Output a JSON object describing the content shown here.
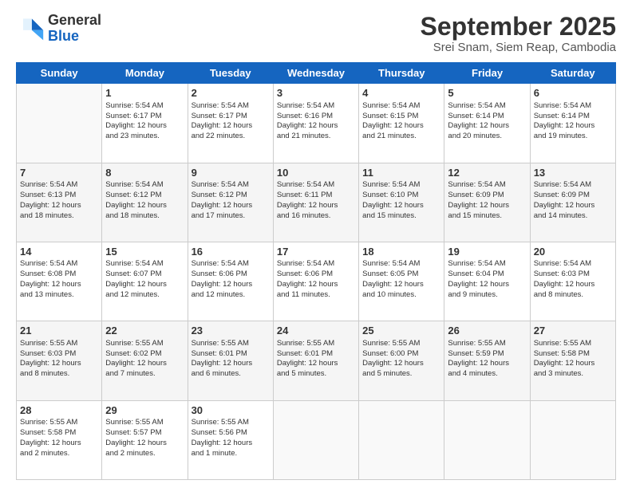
{
  "header": {
    "logo": {
      "general": "General",
      "blue": "Blue"
    },
    "title": "September 2025",
    "location": "Srei Snam, Siem Reap, Cambodia"
  },
  "days_of_week": [
    "Sunday",
    "Monday",
    "Tuesday",
    "Wednesday",
    "Thursday",
    "Friday",
    "Saturday"
  ],
  "weeks": [
    {
      "shade": false,
      "days": [
        {
          "num": "",
          "info": ""
        },
        {
          "num": "1",
          "info": "Sunrise: 5:54 AM\nSunset: 6:17 PM\nDaylight: 12 hours\nand 23 minutes."
        },
        {
          "num": "2",
          "info": "Sunrise: 5:54 AM\nSunset: 6:17 PM\nDaylight: 12 hours\nand 22 minutes."
        },
        {
          "num": "3",
          "info": "Sunrise: 5:54 AM\nSunset: 6:16 PM\nDaylight: 12 hours\nand 21 minutes."
        },
        {
          "num": "4",
          "info": "Sunrise: 5:54 AM\nSunset: 6:15 PM\nDaylight: 12 hours\nand 21 minutes."
        },
        {
          "num": "5",
          "info": "Sunrise: 5:54 AM\nSunset: 6:14 PM\nDaylight: 12 hours\nand 20 minutes."
        },
        {
          "num": "6",
          "info": "Sunrise: 5:54 AM\nSunset: 6:14 PM\nDaylight: 12 hours\nand 19 minutes."
        }
      ]
    },
    {
      "shade": true,
      "days": [
        {
          "num": "7",
          "info": "Sunrise: 5:54 AM\nSunset: 6:13 PM\nDaylight: 12 hours\nand 18 minutes."
        },
        {
          "num": "8",
          "info": "Sunrise: 5:54 AM\nSunset: 6:12 PM\nDaylight: 12 hours\nand 18 minutes."
        },
        {
          "num": "9",
          "info": "Sunrise: 5:54 AM\nSunset: 6:12 PM\nDaylight: 12 hours\nand 17 minutes."
        },
        {
          "num": "10",
          "info": "Sunrise: 5:54 AM\nSunset: 6:11 PM\nDaylight: 12 hours\nand 16 minutes."
        },
        {
          "num": "11",
          "info": "Sunrise: 5:54 AM\nSunset: 6:10 PM\nDaylight: 12 hours\nand 15 minutes."
        },
        {
          "num": "12",
          "info": "Sunrise: 5:54 AM\nSunset: 6:09 PM\nDaylight: 12 hours\nand 15 minutes."
        },
        {
          "num": "13",
          "info": "Sunrise: 5:54 AM\nSunset: 6:09 PM\nDaylight: 12 hours\nand 14 minutes."
        }
      ]
    },
    {
      "shade": false,
      "days": [
        {
          "num": "14",
          "info": "Sunrise: 5:54 AM\nSunset: 6:08 PM\nDaylight: 12 hours\nand 13 minutes."
        },
        {
          "num": "15",
          "info": "Sunrise: 5:54 AM\nSunset: 6:07 PM\nDaylight: 12 hours\nand 12 minutes."
        },
        {
          "num": "16",
          "info": "Sunrise: 5:54 AM\nSunset: 6:06 PM\nDaylight: 12 hours\nand 12 minutes."
        },
        {
          "num": "17",
          "info": "Sunrise: 5:54 AM\nSunset: 6:06 PM\nDaylight: 12 hours\nand 11 minutes."
        },
        {
          "num": "18",
          "info": "Sunrise: 5:54 AM\nSunset: 6:05 PM\nDaylight: 12 hours\nand 10 minutes."
        },
        {
          "num": "19",
          "info": "Sunrise: 5:54 AM\nSunset: 6:04 PM\nDaylight: 12 hours\nand 9 minutes."
        },
        {
          "num": "20",
          "info": "Sunrise: 5:54 AM\nSunset: 6:03 PM\nDaylight: 12 hours\nand 8 minutes."
        }
      ]
    },
    {
      "shade": true,
      "days": [
        {
          "num": "21",
          "info": "Sunrise: 5:55 AM\nSunset: 6:03 PM\nDaylight: 12 hours\nand 8 minutes."
        },
        {
          "num": "22",
          "info": "Sunrise: 5:55 AM\nSunset: 6:02 PM\nDaylight: 12 hours\nand 7 minutes."
        },
        {
          "num": "23",
          "info": "Sunrise: 5:55 AM\nSunset: 6:01 PM\nDaylight: 12 hours\nand 6 minutes."
        },
        {
          "num": "24",
          "info": "Sunrise: 5:55 AM\nSunset: 6:01 PM\nDaylight: 12 hours\nand 5 minutes."
        },
        {
          "num": "25",
          "info": "Sunrise: 5:55 AM\nSunset: 6:00 PM\nDaylight: 12 hours\nand 5 minutes."
        },
        {
          "num": "26",
          "info": "Sunrise: 5:55 AM\nSunset: 5:59 PM\nDaylight: 12 hours\nand 4 minutes."
        },
        {
          "num": "27",
          "info": "Sunrise: 5:55 AM\nSunset: 5:58 PM\nDaylight: 12 hours\nand 3 minutes."
        }
      ]
    },
    {
      "shade": false,
      "days": [
        {
          "num": "28",
          "info": "Sunrise: 5:55 AM\nSunset: 5:58 PM\nDaylight: 12 hours\nand 2 minutes."
        },
        {
          "num": "29",
          "info": "Sunrise: 5:55 AM\nSunset: 5:57 PM\nDaylight: 12 hours\nand 2 minutes."
        },
        {
          "num": "30",
          "info": "Sunrise: 5:55 AM\nSunset: 5:56 PM\nDaylight: 12 hours\nand 1 minute."
        },
        {
          "num": "",
          "info": ""
        },
        {
          "num": "",
          "info": ""
        },
        {
          "num": "",
          "info": ""
        },
        {
          "num": "",
          "info": ""
        }
      ]
    }
  ]
}
